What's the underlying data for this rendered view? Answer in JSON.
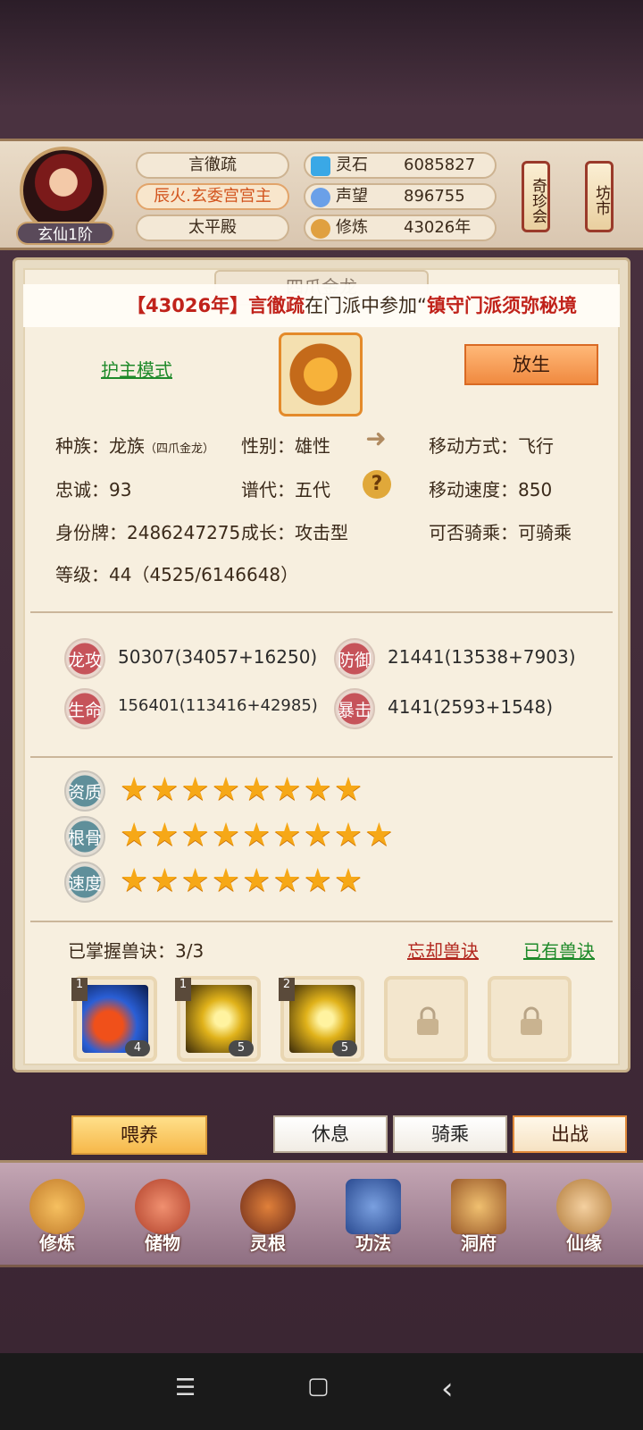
{
  "player": {
    "name": "言徹疏",
    "title": "辰火.玄委宫宫主",
    "palace": "太平殿",
    "rank": "玄仙1阶"
  },
  "resources": [
    {
      "label": "灵石",
      "value": "6085827",
      "icon": "spirit-stone-icon"
    },
    {
      "label": "声望",
      "value": "896755",
      "icon": "reputation-icon"
    },
    {
      "label": "修炼",
      "value": "43026年",
      "icon": "meditation-icon"
    }
  ],
  "shops": {
    "treasure": "奇珍会",
    "market": "坊市"
  },
  "pet": {
    "tab_title": "四爪金龙",
    "mode": "护主模式",
    "release": "放生",
    "info": {
      "race_label": "种族：",
      "race": "龙族",
      "race_sub": "（四爪金龙）",
      "gender_label": "性别：",
      "gender": "雄性",
      "move_label": "移动方式：",
      "move": "飞行",
      "loyalty_label": "忠诚：",
      "loyalty": "93",
      "generation_label": "谱代：",
      "generation": "五代",
      "speed_label": "移动速度：",
      "speed": "850",
      "id_label": "身份牌：",
      "id": "2486247275",
      "growth_label": "成长：",
      "growth": "攻击型",
      "ride_label": "可否骑乘：",
      "ride": "可骑乘",
      "level_label": "等级：",
      "level": "44（4525/6146648）"
    },
    "stats": [
      {
        "label": "龙攻",
        "value": "50307(34057+16250)"
      },
      {
        "label": "防御",
        "value": "21441(13538+7903)"
      },
      {
        "label": "生命",
        "value": "156401(113416+42985)"
      },
      {
        "label": "暴击",
        "value": "4141(2593+1548)"
      }
    ],
    "attributes": [
      {
        "label": "资质",
        "stars": 8,
        "stars_text": "★★★★★★★★"
      },
      {
        "label": "根骨",
        "stars": 9,
        "stars_text": "★★★★★★★★★"
      },
      {
        "label": "速度",
        "stars": 8,
        "stars_text": "★★★★★★★★"
      }
    ],
    "skills_label": "已掌握兽诀：3/3",
    "forget": "忘却兽诀",
    "owned": "已有兽诀",
    "skills": [
      {
        "tier": "1",
        "count": "4",
        "color": "#2a5fd6"
      },
      {
        "tier": "1",
        "count": "5",
        "color": "#e0b21a"
      },
      {
        "tier": "2",
        "count": "5",
        "color": "#e0b21a"
      }
    ]
  },
  "marquee": {
    "open": "【",
    "year": "43026年",
    "close": "】",
    "name": "言徹疏",
    "text": "在门派中参加“",
    "event": "镇守门派须弥秘境"
  },
  "actions": {
    "feed": "喂养",
    "rest": "休息",
    "ride": "骑乘",
    "battle": "出战"
  },
  "nav": [
    {
      "label": "修炼",
      "icon": "cultivate-icon",
      "color": "#e0a040"
    },
    {
      "label": "储物",
      "icon": "storage-bag-icon",
      "color": "#d0603a"
    },
    {
      "label": "灵根",
      "icon": "spirit-root-icon",
      "color": "#8a3a2a"
    },
    {
      "label": "功法",
      "icon": "scripture-book-icon",
      "color": "#3a6ab0"
    },
    {
      "label": "洞府",
      "icon": "cave-palace-icon",
      "color": "#c08a3a"
    },
    {
      "label": "仙缘",
      "icon": "fortune-gourd-icon",
      "color": "#d8a060"
    }
  ],
  "system": {
    "menu": "☰",
    "home": "▢",
    "back": "‹"
  }
}
